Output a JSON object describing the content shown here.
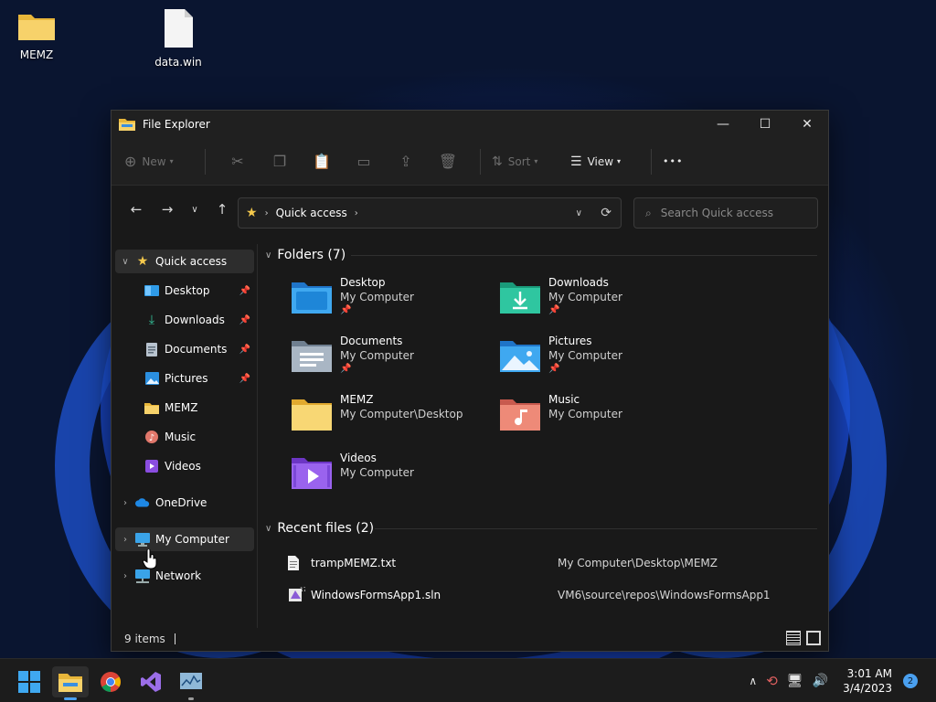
{
  "desktop": {
    "icons": [
      {
        "label": "MEMZ",
        "icon": "folder-icon"
      },
      {
        "label": "data.win",
        "icon": "file-icon"
      }
    ]
  },
  "window": {
    "title": "File Explorer",
    "minimize": "—",
    "maximize": "☐",
    "close": "✕"
  },
  "toolbar": {
    "new_label": "New",
    "sort_label": "Sort",
    "view_label": "View",
    "more_label": "•••"
  },
  "address": {
    "breadcrumb": "Quick access",
    "search_placeholder": "Search Quick access"
  },
  "sidebar": {
    "items": [
      {
        "label": "Quick access",
        "icon": "star-icon",
        "pinned": false
      },
      {
        "label": "Desktop",
        "icon": "desktop-icon",
        "pinned": true
      },
      {
        "label": "Downloads",
        "icon": "download-icon",
        "pinned": true
      },
      {
        "label": "Documents",
        "icon": "documents-icon",
        "pinned": true
      },
      {
        "label": "Pictures",
        "icon": "pictures-icon",
        "pinned": true
      },
      {
        "label": "MEMZ",
        "icon": "folder-icon",
        "pinned": false
      },
      {
        "label": "Music",
        "icon": "music-icon",
        "pinned": false
      },
      {
        "label": "Videos",
        "icon": "videos-icon",
        "pinned": false
      },
      {
        "label": "OneDrive",
        "icon": "cloud-icon",
        "pinned": false
      },
      {
        "label": "My Computer",
        "icon": "computer-icon",
        "pinned": false
      },
      {
        "label": "Network",
        "icon": "network-icon",
        "pinned": false
      }
    ]
  },
  "folders": {
    "heading": "Folders (7)",
    "items": [
      {
        "name": "Desktop",
        "location": "My Computer",
        "pinned": true
      },
      {
        "name": "Downloads",
        "location": "My Computer",
        "pinned": true
      },
      {
        "name": "Documents",
        "location": "My Computer",
        "pinned": true
      },
      {
        "name": "Pictures",
        "location": "My Computer",
        "pinned": true
      },
      {
        "name": "MEMZ",
        "location": "My Computer\\Desktop",
        "pinned": false
      },
      {
        "name": "Music",
        "location": "My Computer",
        "pinned": false
      },
      {
        "name": "Videos",
        "location": "My Computer",
        "pinned": false
      }
    ]
  },
  "recent": {
    "heading": "Recent files (2)",
    "items": [
      {
        "name": "trampMEMZ.txt",
        "location": "My Computer\\Desktop\\MEMZ"
      },
      {
        "name": "WindowsFormsApp1.sln",
        "location": "VM6\\source\\repos\\WindowsFormsApp1"
      }
    ]
  },
  "status": {
    "count": "9 items"
  },
  "taskbar": {
    "time": "3:01 AM",
    "date": "3/4/2023",
    "notifications": "2"
  },
  "colors": {
    "accent": "#4aa0f0",
    "folder_yellow": "#f5c94c",
    "window_bg": "#191919"
  }
}
